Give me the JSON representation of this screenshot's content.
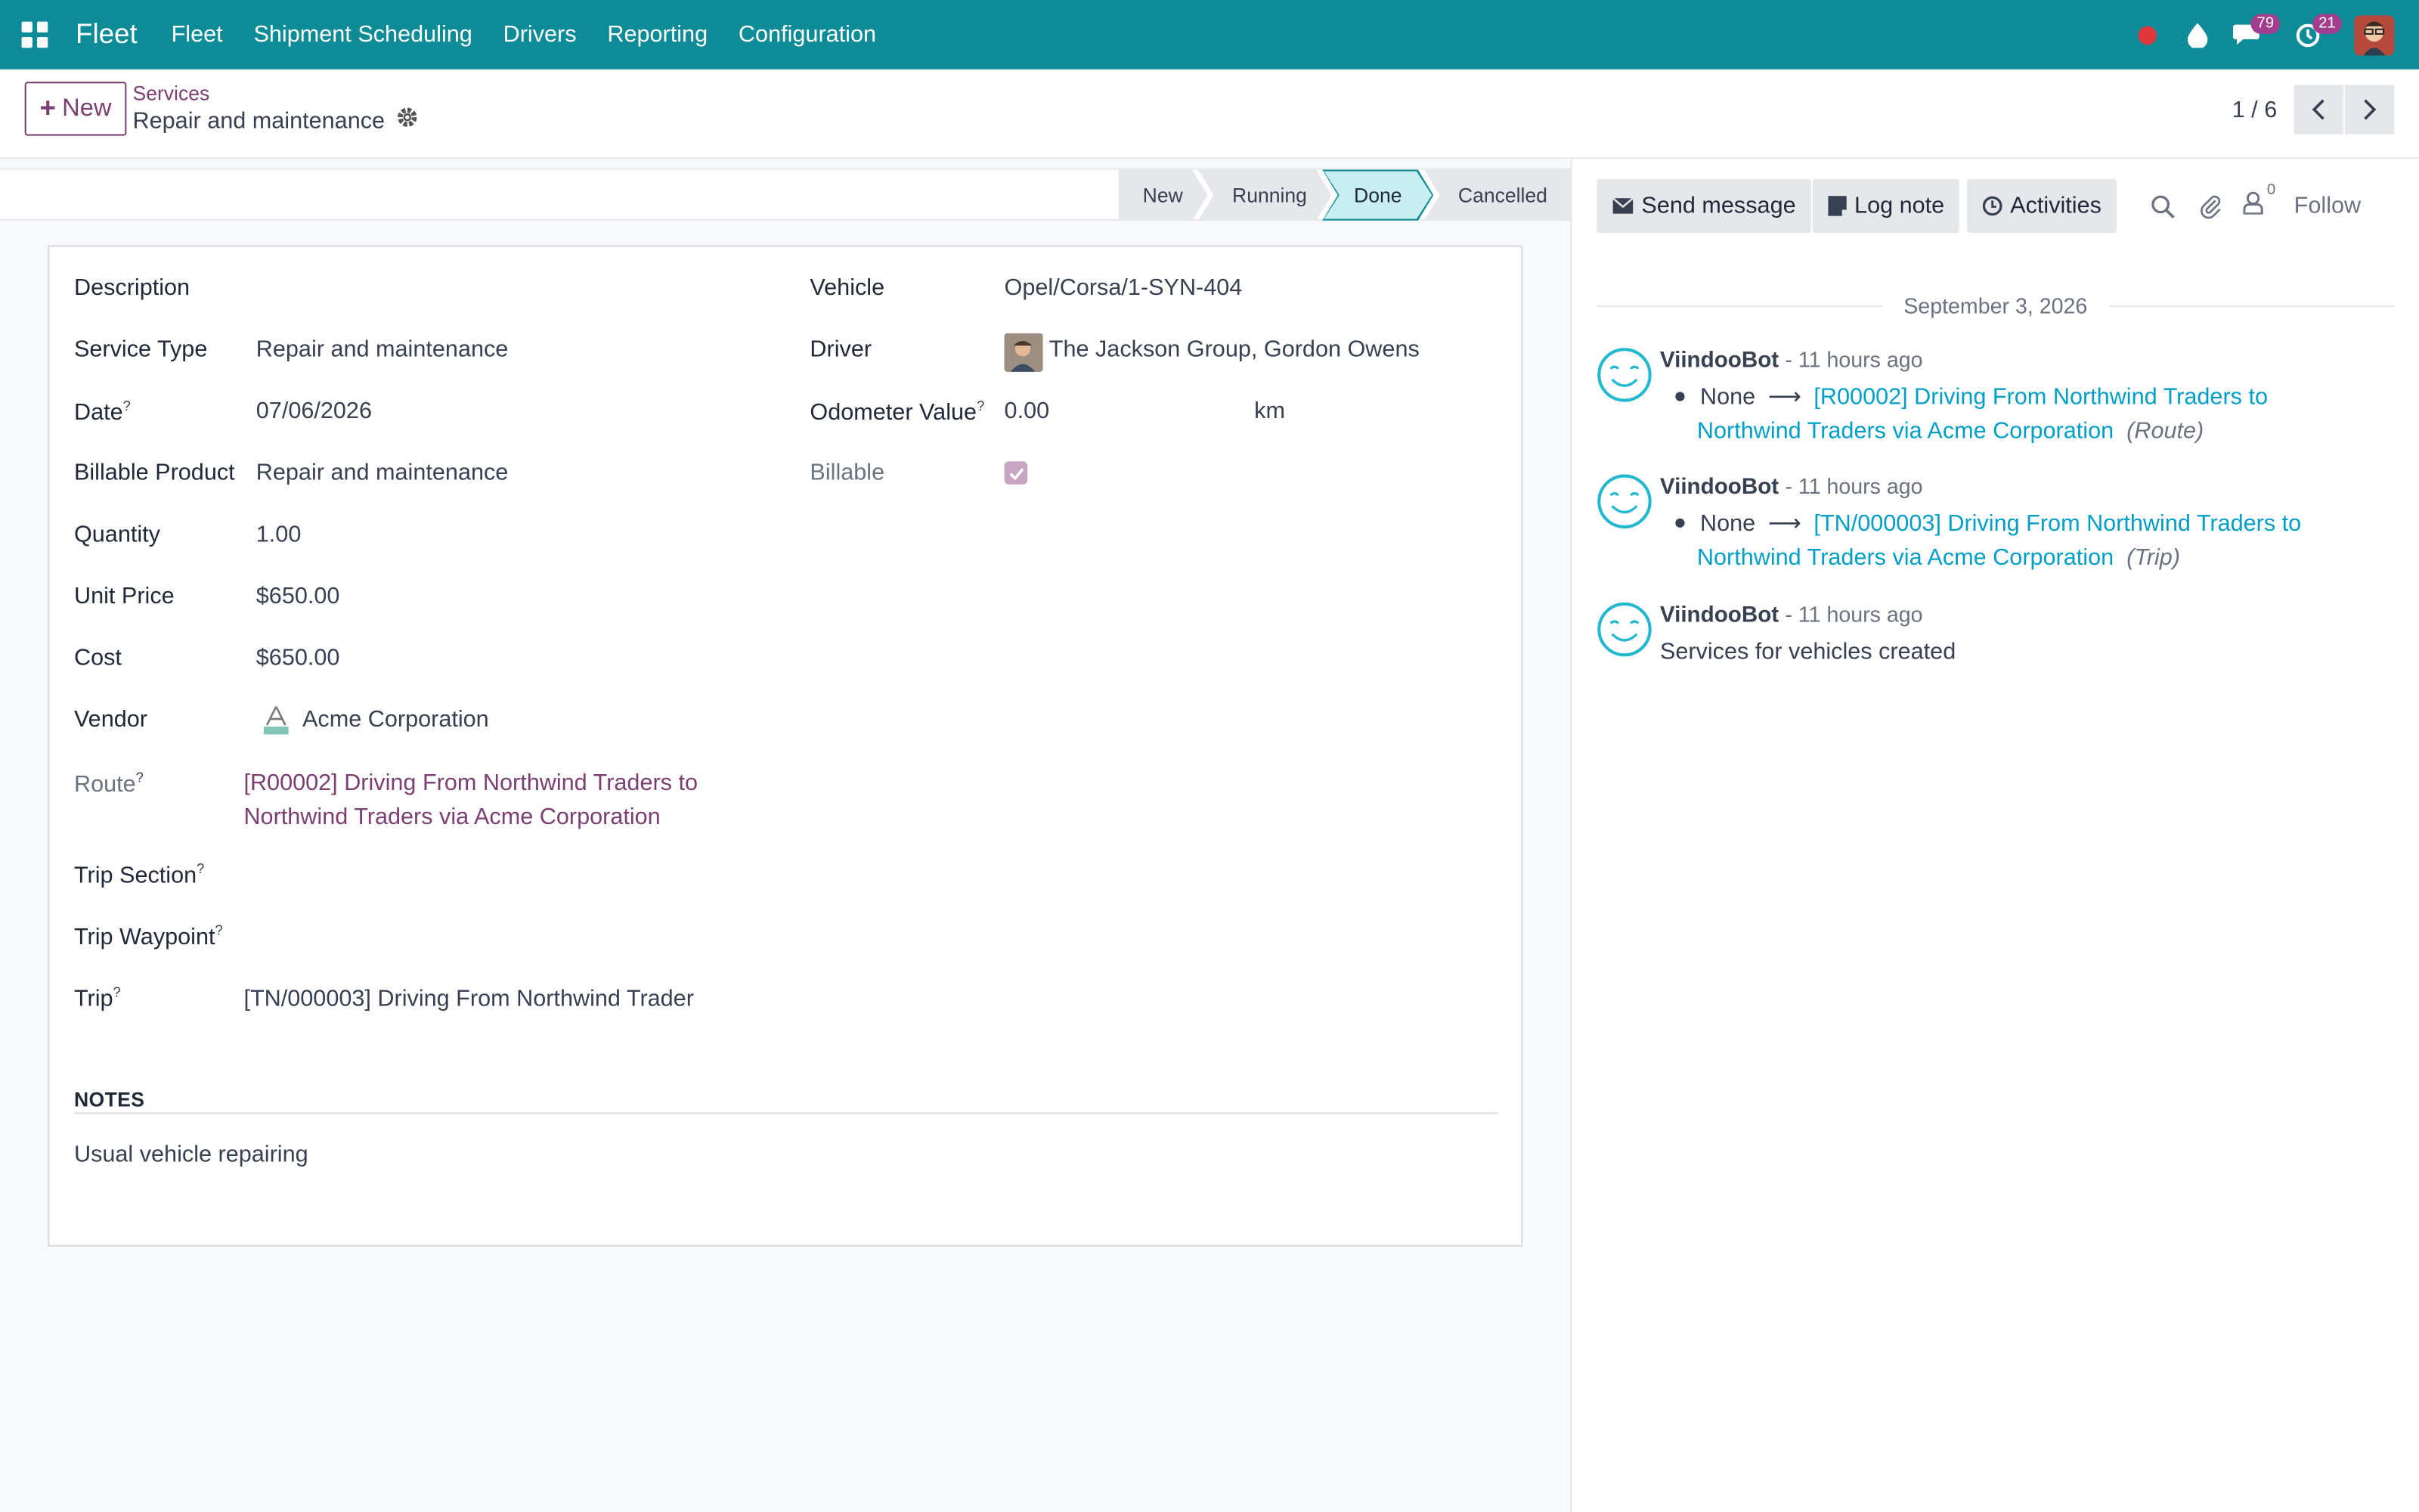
{
  "navbar": {
    "brand": "Fleet",
    "menu": [
      "Fleet",
      "Shipment Scheduling",
      "Drivers",
      "Reporting",
      "Configuration"
    ],
    "badges": {
      "messages": "79",
      "activities": "21"
    }
  },
  "control": {
    "new_label": "New",
    "breadcrumb": "Services",
    "record_title": "Repair and maintenance",
    "pager": "1 / 6"
  },
  "status": {
    "stages": [
      "New",
      "Running",
      "Done",
      "Cancelled"
    ],
    "active": "Done"
  },
  "form": {
    "left": {
      "description_label": "Description",
      "service_type_label": "Service Type",
      "service_type": "Repair and maintenance",
      "date_label": "Date",
      "date": "07/06/2026",
      "billable_product_label": "Billable Product",
      "billable_product": "Repair and maintenance",
      "quantity_label": "Quantity",
      "quantity": "1.00",
      "unit_price_label": "Unit Price",
      "unit_price": "$650.00",
      "cost_label": "Cost",
      "cost": "$650.00",
      "vendor_label": "Vendor",
      "vendor": "Acme Corporation",
      "route_label": "Route",
      "route_line1": "[R00002] Driving From Northwind Traders to",
      "route_line2": "Northwind Traders via Acme Corporation",
      "trip_section_label": "Trip Section",
      "trip_waypoint_label": "Trip Waypoint",
      "trip_label": "Trip",
      "trip": "[TN/000003] Driving From Northwind Trader"
    },
    "right": {
      "vehicle_label": "Vehicle",
      "vehicle": "Opel/Corsa/1-SYN-404",
      "driver_label": "Driver",
      "driver": "The Jackson Group, Gordon Owens",
      "odometer_label": "Odometer Value",
      "odometer": "0.00",
      "odometer_unit": "km",
      "billable_label": "Billable",
      "billable": true
    },
    "help_mark": "?",
    "notes_heading": "NOTES",
    "notes_text": "Usual vehicle repairing"
  },
  "chatter": {
    "send_message": "Send message",
    "log_note": "Log note",
    "activities": "Activities",
    "followers_count": "0",
    "follow": "Follow",
    "date": "September 3, 2026",
    "messages": [
      {
        "author": "ViindooBot",
        "time": "- 11 hours ago",
        "old": "None",
        "link_line1": "[R00002] Driving From Northwind Traders to",
        "link_line2": "Northwind Traders via Acme Corporation",
        "field": "(Route)"
      },
      {
        "author": "ViindooBot",
        "time": "- 11 hours ago",
        "old": "None",
        "link_line1": "[TN/000003] Driving From Northwind Traders to",
        "link_line2": "Northwind Traders via Acme Corporation",
        "field": "(Trip)"
      },
      {
        "author": "ViindooBot",
        "time": "- 11 hours ago",
        "text": "Services for vehicles created"
      }
    ]
  },
  "colors": {
    "navbar": "#0d8b96",
    "primary": "#7b3f72",
    "link": "#019fc8",
    "active_stage": "#c9eef2"
  }
}
